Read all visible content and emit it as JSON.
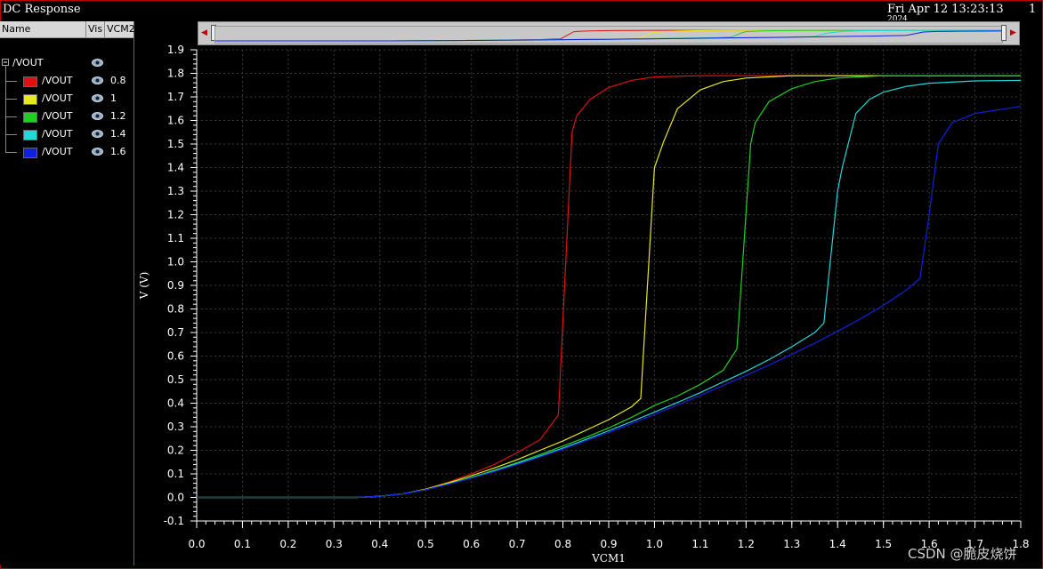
{
  "window": {
    "title": "DC Response",
    "timestamp": "Fri Apr 12 13:23:13",
    "timestamp_line2": "2024",
    "page_number": "1"
  },
  "legend": {
    "headers": {
      "name": "Name",
      "vis": "Vis",
      "param": "VCM2"
    },
    "group_label": "/VOUT",
    "items": [
      {
        "name": "/VOUT",
        "value": "0.8",
        "color": "#e01010"
      },
      {
        "name": "/VOUT",
        "value": "1",
        "color": "#e8e820"
      },
      {
        "name": "/VOUT",
        "value": "1.2",
        "color": "#20d020"
      },
      {
        "name": "/VOUT",
        "value": "1.4",
        "color": "#20d8d8"
      },
      {
        "name": "/VOUT",
        "value": "1.6",
        "color": "#1020e0"
      }
    ]
  },
  "watermark": "CSDN @脆皮烧饼",
  "chart_data": {
    "type": "line",
    "xlabel": "VCM1",
    "ylabel": "V (V)",
    "xlim": [
      0.0,
      1.8
    ],
    "ylim": [
      -0.1,
      1.9
    ],
    "xticks": [
      "0.0",
      "0.1",
      "0.2",
      "0.3",
      "0.4",
      "0.5",
      "0.6",
      "0.7",
      "0.8",
      "0.9",
      "1.0",
      "1.1",
      "1.2",
      "1.3",
      "1.4",
      "1.5",
      "1.6",
      "1.7",
      "1.8"
    ],
    "yticks": [
      "-0.1",
      "0.0",
      "0.1",
      "0.2",
      "0.3",
      "0.4",
      "0.5",
      "0.6",
      "0.7",
      "0.8",
      "0.9",
      "1.0",
      "1.1",
      "1.2",
      "1.3",
      "1.4",
      "1.5",
      "1.6",
      "1.7",
      "1.8",
      "1.9"
    ],
    "grid": true,
    "series": [
      {
        "name": "/VOUT 0.8",
        "color": "#e01010",
        "x": [
          0.0,
          0.35,
          0.4,
          0.45,
          0.5,
          0.55,
          0.6,
          0.65,
          0.7,
          0.75,
          0.79,
          0.82,
          0.83,
          0.86,
          0.9,
          0.95,
          1.0,
          1.1,
          1.3,
          1.5,
          1.8
        ],
        "y": [
          0.0,
          0.0,
          0.005,
          0.015,
          0.035,
          0.065,
          0.1,
          0.14,
          0.19,
          0.245,
          0.35,
          1.55,
          1.62,
          1.69,
          1.74,
          1.77,
          1.785,
          1.79,
          1.79,
          1.79,
          1.79
        ]
      },
      {
        "name": "/VOUT 1",
        "color": "#e8e820",
        "x": [
          0.0,
          0.35,
          0.4,
          0.45,
          0.5,
          0.55,
          0.6,
          0.65,
          0.7,
          0.75,
          0.8,
          0.85,
          0.9,
          0.95,
          0.97,
          1.0,
          1.02,
          1.05,
          1.1,
          1.15,
          1.2,
          1.3,
          1.5,
          1.8
        ],
        "y": [
          0.0,
          0.0,
          0.005,
          0.015,
          0.035,
          0.062,
          0.092,
          0.125,
          0.16,
          0.2,
          0.24,
          0.285,
          0.33,
          0.385,
          0.42,
          1.4,
          1.51,
          1.65,
          1.73,
          1.765,
          1.78,
          1.79,
          1.79,
          1.79
        ]
      },
      {
        "name": "/VOUT 1.2",
        "color": "#20d020",
        "x": [
          0.0,
          0.35,
          0.4,
          0.45,
          0.5,
          0.55,
          0.6,
          0.65,
          0.7,
          0.75,
          0.8,
          0.85,
          0.9,
          0.95,
          1.0,
          1.05,
          1.1,
          1.15,
          1.18,
          1.21,
          1.22,
          1.25,
          1.3,
          1.35,
          1.4,
          1.5,
          1.8
        ],
        "y": [
          0.0,
          0.0,
          0.005,
          0.015,
          0.033,
          0.058,
          0.085,
          0.115,
          0.148,
          0.182,
          0.218,
          0.255,
          0.295,
          0.34,
          0.39,
          0.43,
          0.48,
          0.54,
          0.63,
          1.5,
          1.59,
          1.68,
          1.735,
          1.765,
          1.78,
          1.79,
          1.79
        ]
      },
      {
        "name": "/VOUT 1.4",
        "color": "#20d8d8",
        "x": [
          0.0,
          0.35,
          0.4,
          0.45,
          0.5,
          0.55,
          0.6,
          0.65,
          0.7,
          0.75,
          0.8,
          0.85,
          0.9,
          0.95,
          1.0,
          1.05,
          1.1,
          1.15,
          1.2,
          1.25,
          1.3,
          1.35,
          1.37,
          1.4,
          1.41,
          1.44,
          1.47,
          1.5,
          1.55,
          1.6,
          1.7,
          1.8
        ],
        "y": [
          0.0,
          0.0,
          0.005,
          0.015,
          0.033,
          0.057,
          0.083,
          0.112,
          0.143,
          0.176,
          0.21,
          0.246,
          0.283,
          0.322,
          0.362,
          0.403,
          0.445,
          0.49,
          0.535,
          0.585,
          0.64,
          0.7,
          0.74,
          1.3,
          1.4,
          1.63,
          1.69,
          1.72,
          1.745,
          1.758,
          1.768,
          1.77
        ]
      },
      {
        "name": "/VOUT 1.6",
        "color": "#1020e0",
        "x": [
          0.0,
          0.35,
          0.4,
          0.45,
          0.5,
          0.55,
          0.6,
          0.65,
          0.7,
          0.75,
          0.8,
          0.85,
          0.9,
          0.95,
          1.0,
          1.05,
          1.1,
          1.15,
          1.2,
          1.25,
          1.3,
          1.35,
          1.4,
          1.45,
          1.5,
          1.55,
          1.58,
          1.6,
          1.62,
          1.65,
          1.7,
          1.8
        ],
        "y": [
          0.0,
          0.0,
          0.005,
          0.015,
          0.033,
          0.056,
          0.082,
          0.11,
          0.14,
          0.172,
          0.205,
          0.24,
          0.276,
          0.313,
          0.352,
          0.392,
          0.433,
          0.475,
          0.518,
          0.562,
          0.607,
          0.655,
          0.705,
          0.758,
          0.815,
          0.88,
          0.93,
          1.2,
          1.5,
          1.59,
          1.63,
          1.66
        ]
      }
    ]
  }
}
